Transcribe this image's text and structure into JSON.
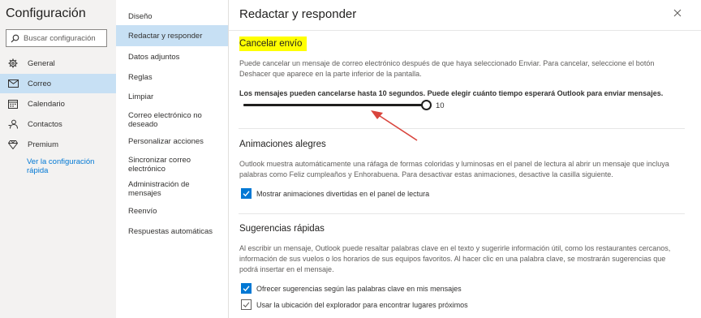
{
  "sidebar": {
    "title": "Configuración",
    "search_placeholder": "Buscar configuración",
    "items": [
      {
        "label": "General",
        "icon": "gear-icon"
      },
      {
        "label": "Correo",
        "icon": "mail-icon",
        "active": true
      },
      {
        "label": "Calendario",
        "icon": "calendar-icon"
      },
      {
        "label": "Contactos",
        "icon": "contacts-icon"
      },
      {
        "label": "Premium",
        "icon": "diamond-icon"
      }
    ],
    "quick_link": "Ver la configuración rápida"
  },
  "subnav": {
    "items": [
      {
        "label": "Diseño"
      },
      {
        "label": "Redactar y responder",
        "active": true
      },
      {
        "label": "Datos adjuntos"
      },
      {
        "label": "Reglas"
      },
      {
        "label": "Limpiar"
      },
      {
        "label": "Correo electrónico no deseado"
      },
      {
        "label": "Personalizar acciones"
      },
      {
        "label": "Sincronizar correo electrónico"
      },
      {
        "label": "Administración de mensajes"
      },
      {
        "label": "Reenvío"
      },
      {
        "label": "Respuestas automáticas"
      }
    ]
  },
  "content": {
    "title": "Redactar y responder",
    "cancel": {
      "title": "Cancelar envío",
      "description": "Puede cancelar un mensaje de correo electrónico después de que haya seleccionado Enviar. Para cancelar, seleccione el botón Deshacer que aparece en la parte inferior de la pantalla.",
      "detail": "Los mensajes pueden cancelarse hasta 10 segundos. Puede elegir cuánto tiempo esperará Outlook para enviar mensajes.",
      "slider_value": "10",
      "slider_fraction": 1.0
    },
    "animations": {
      "title": "Animaciones alegres",
      "description": "Outlook muestra automáticamente una ráfaga de formas coloridas y luminosas en el panel de lectura al abrir un mensaje que incluya palabras como Feliz cumpleaños y Enhorabuena. Para desactivar estas animaciones, desactive la casilla siguiente.",
      "checkbox_label": "Mostrar animaciones divertidas en el panel de lectura",
      "checked": true
    },
    "suggestions": {
      "title": "Sugerencias rápidas",
      "description": "Al escribir un mensaje, Outlook puede resaltar palabras clave en el texto y sugerirle información útil, como los restaurantes cercanos, información de sus vuelos o los horarios de sus equipos favoritos. Al hacer clic en una palabra clave, se mostrarán sugerencias que podrá insertar en el mensaje.",
      "checkbox1_label": "Ofrecer sugerencias según las palabras clave en mis mensajes",
      "checkbox1_checked": true,
      "checkbox2_label": "Usar la ubicación del explorador para encontrar lugares próximos",
      "checkbox2_checked": false
    }
  },
  "colors": {
    "accent": "#0078d4",
    "selected_bg": "#c7e0f4",
    "highlight": "#ffff00",
    "annotation_arrow": "#d9443c"
  }
}
